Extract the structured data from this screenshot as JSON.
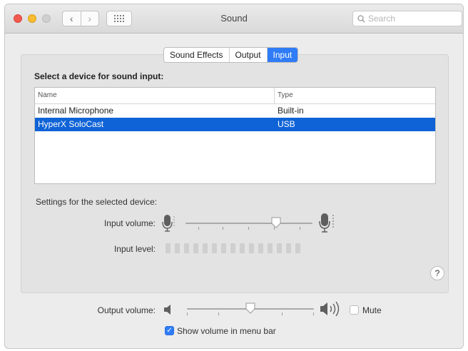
{
  "window": {
    "title": "Sound",
    "search_placeholder": "Search"
  },
  "tabs": [
    {
      "label": "Sound Effects",
      "active": false
    },
    {
      "label": "Output",
      "active": false
    },
    {
      "label": "Input",
      "active": true
    }
  ],
  "device_section": {
    "title": "Select a device for sound input:",
    "columns": [
      "Name",
      "Type"
    ],
    "rows": [
      {
        "name": "Internal Microphone",
        "type": "Built-in",
        "selected": false
      },
      {
        "name": "HyperX SoloCast",
        "type": "USB",
        "selected": true
      }
    ]
  },
  "settings": {
    "title": "Settings for the selected device:",
    "input_volume_label": "Input volume:",
    "input_volume_level": 0.73,
    "input_level_label": "Input level:",
    "input_level_bars_total": 15,
    "input_level_bars_lit": 0
  },
  "help_label": "?",
  "output": {
    "volume_label": "Output volume:",
    "volume_level": 0.5,
    "mute_label": "Mute",
    "mute_checked": false,
    "show_in_menu_label": "Show volume in menu bar",
    "show_in_menu_checked": true
  },
  "colors": {
    "accent": "#2f7cf6",
    "selection": "#0f63d6",
    "close": "#f25a4f",
    "minimize": "#f7bc2f"
  },
  "icons": {
    "back": "chevron-left-icon",
    "forward": "chevron-right-icon",
    "show_all": "grid-icon",
    "search": "search-icon",
    "mic_low": "microphone-low-icon",
    "mic_high": "microphone-high-icon",
    "speaker_low": "speaker-low-icon",
    "speaker_high": "speaker-high-icon",
    "help": "question-icon",
    "checkmark": "checkmark-icon"
  }
}
